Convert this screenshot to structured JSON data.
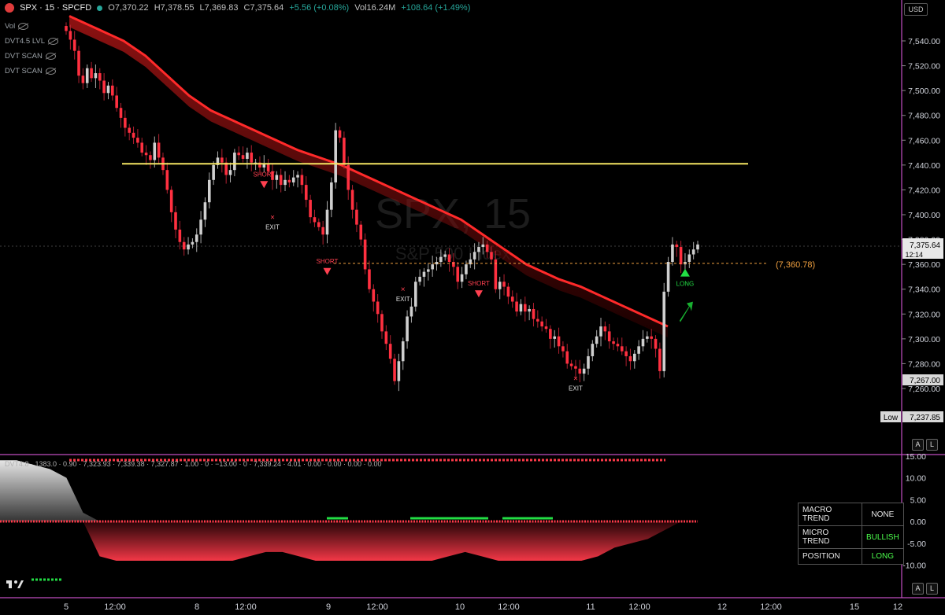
{
  "header": {
    "symbol": "SPX · 15 · SPCFD",
    "open": "O7,370.22",
    "high": "H7,378.55",
    "low": "L7,369.83",
    "close": "C7,375.64",
    "change": "+5.56 (+0.08%)",
    "volume": "Vol16.24M",
    "vol_change": "+108.64 (+1.49%)"
  },
  "indicators": [
    "Vol",
    "DVT4.5 LVL",
    "DVT SCAN",
    "DVT SCAN"
  ],
  "currency": "USD",
  "watermark": {
    "title": "SPX, 15",
    "subtitle": "S&P 500 Index"
  },
  "price_labels": {
    "last": "7,375.64",
    "countdown": "12:14",
    "level": "(7,360.78)",
    "low_tag": "Low",
    "low_value": "7,237.85",
    "prev": "7,267.00"
  },
  "axis_buttons": {
    "auto": "A",
    "log": "L"
  },
  "oscillator": {
    "label": "DVT4.8 · 1383.0 · 0.90 · 7,323.93 · 7,339.38 · 7,327.87 · 1.00 · 0 · −13.00 · 0 · 7,339.24 · 4.01 · 0.00 · 0.00 · 0.00 · 0.00",
    "yticks": [
      "15.00",
      "10.00",
      "5.00",
      "0.00",
      "-5.00",
      "-10.00"
    ]
  },
  "trend_table": [
    {
      "key": "MACRO TREND",
      "value": "NONE",
      "color": "#e6e6e6"
    },
    {
      "key": "MICRO TREND",
      "value": "BULLISH",
      "color": "#4cff4c"
    },
    {
      "key": "POSITION",
      "value": "LONG",
      "color": "#4cff4c"
    }
  ],
  "chart_data": {
    "type": "candlestick",
    "price_axis": {
      "ticks": [
        7540,
        7520,
        7500,
        7480,
        7460,
        7440,
        7420,
        7400,
        7380,
        7360,
        7340,
        7320,
        7300,
        7280,
        7260
      ],
      "tick_labels": [
        "7,540.00",
        "7,520.00",
        "7,500.00",
        "7,480.00",
        "7,460.00",
        "7,440.00",
        "7,420.00",
        "7,400.00",
        "7,380.00",
        "7,360.00",
        "7,340.00",
        "7,320.00",
        "7,300.00",
        "7,280.00",
        "7,260.00"
      ],
      "range": [
        7230,
        7560
      ]
    },
    "x_axis": {
      "labels": [
        "5",
        "12:00",
        "8",
        "12:00",
        "9",
        "12:00",
        "10",
        "12:00",
        "11",
        "12:00",
        "12",
        "12:00",
        "15",
        "12"
      ]
    },
    "closes": [
      7548,
      7541,
      7532,
      7512,
      7506,
      7518,
      7510,
      7514,
      7508,
      7498,
      7504,
      7496,
      7486,
      7478,
      7470,
      7466,
      7462,
      7458,
      7450,
      7448,
      7444,
      7458,
      7446,
      7436,
      7420,
      7402,
      7388,
      7378,
      7372,
      7376,
      7378,
      7384,
      7396,
      7410,
      7428,
      7440,
      7446,
      7442,
      7432,
      7436,
      7450,
      7448,
      7445,
      7450,
      7442,
      7442,
      7438,
      7441,
      7435,
      7428,
      7432,
      7424,
      7428,
      7426,
      7430,
      7432,
      7424,
      7412,
      7398,
      7394,
      7390,
      7384,
      7404,
      7426,
      7468,
      7462,
      7440,
      7420,
      7404,
      7392,
      7380,
      7356,
      7340,
      7330,
      7320,
      7306,
      7296,
      7284,
      7266,
      7282,
      7298,
      7318,
      7326,
      7346,
      7350,
      7354,
      7356,
      7360,
      7362,
      7366,
      7368,
      7362,
      7358,
      7346,
      7352,
      7360,
      7364,
      7370,
      7374,
      7376,
      7370,
      7364,
      7340,
      7346,
      7342,
      7334,
      7330,
      7322,
      7328,
      7322,
      7324,
      7316,
      7314,
      7310,
      7308,
      7300,
      7302,
      7294,
      7290,
      7280,
      7278,
      7276,
      7272,
      7276,
      7286,
      7296,
      7302,
      7310,
      7306,
      7298,
      7296,
      7294,
      7290,
      7286,
      7282,
      7288,
      7294,
      7300,
      7302,
      7300,
      7292,
      7274,
      7338,
      7362,
      7376,
      7374,
      7360,
      7362,
      7368,
      7372,
      7376
    ],
    "ema_band": [
      7560,
      7556,
      7552,
      7548,
      7544,
      7540,
      7534,
      7528,
      7520,
      7512,
      7504,
      7496,
      7490,
      7484,
      7480,
      7476,
      7472,
      7468,
      7464,
      7460,
      7456,
      7452,
      7449,
      7446,
      7443,
      7440,
      7436,
      7432,
      7428,
      7424,
      7420,
      7416,
      7412,
      7408,
      7404,
      7400,
      7396,
      7390,
      7384,
      7378,
      7372,
      7366,
      7360,
      7356,
      7352,
      7348,
      7345,
      7342,
      7338,
      7334,
      7330,
      7326,
      7322,
      7318,
      7314,
      7310
    ],
    "resistance_line": 7441,
    "marked_level": 7360.78,
    "signals": [
      {
        "label": "SHORT",
        "x_index": 47,
        "price": 7422
      },
      {
        "label": "EXIT",
        "x_index": 49,
        "price": 7396
      },
      {
        "label": "SHORT",
        "x_index": 62,
        "price": 7352
      },
      {
        "label": "EXIT",
        "x_index": 80,
        "price": 7338
      },
      {
        "label": "SHORT",
        "x_index": 98,
        "price": 7334
      },
      {
        "label": "EXIT",
        "x_index": 121,
        "price": 7266
      },
      {
        "label": "LONG",
        "x_index": 147,
        "price": 7354
      }
    ],
    "oscillator_values": [
      14,
      14,
      13,
      12,
      10,
      2,
      -8,
      -9,
      -9,
      -9,
      -9,
      -9,
      -9,
      -9,
      -9,
      -8,
      -7,
      -7,
      -8,
      -9,
      -9,
      -9,
      -9,
      -9,
      -9,
      -9,
      -9,
      -8,
      -7,
      -8,
      -9,
      -9,
      -9,
      -9,
      -9,
      -9,
      -8,
      -6,
      -5,
      -4,
      -2,
      0,
      3
    ]
  }
}
